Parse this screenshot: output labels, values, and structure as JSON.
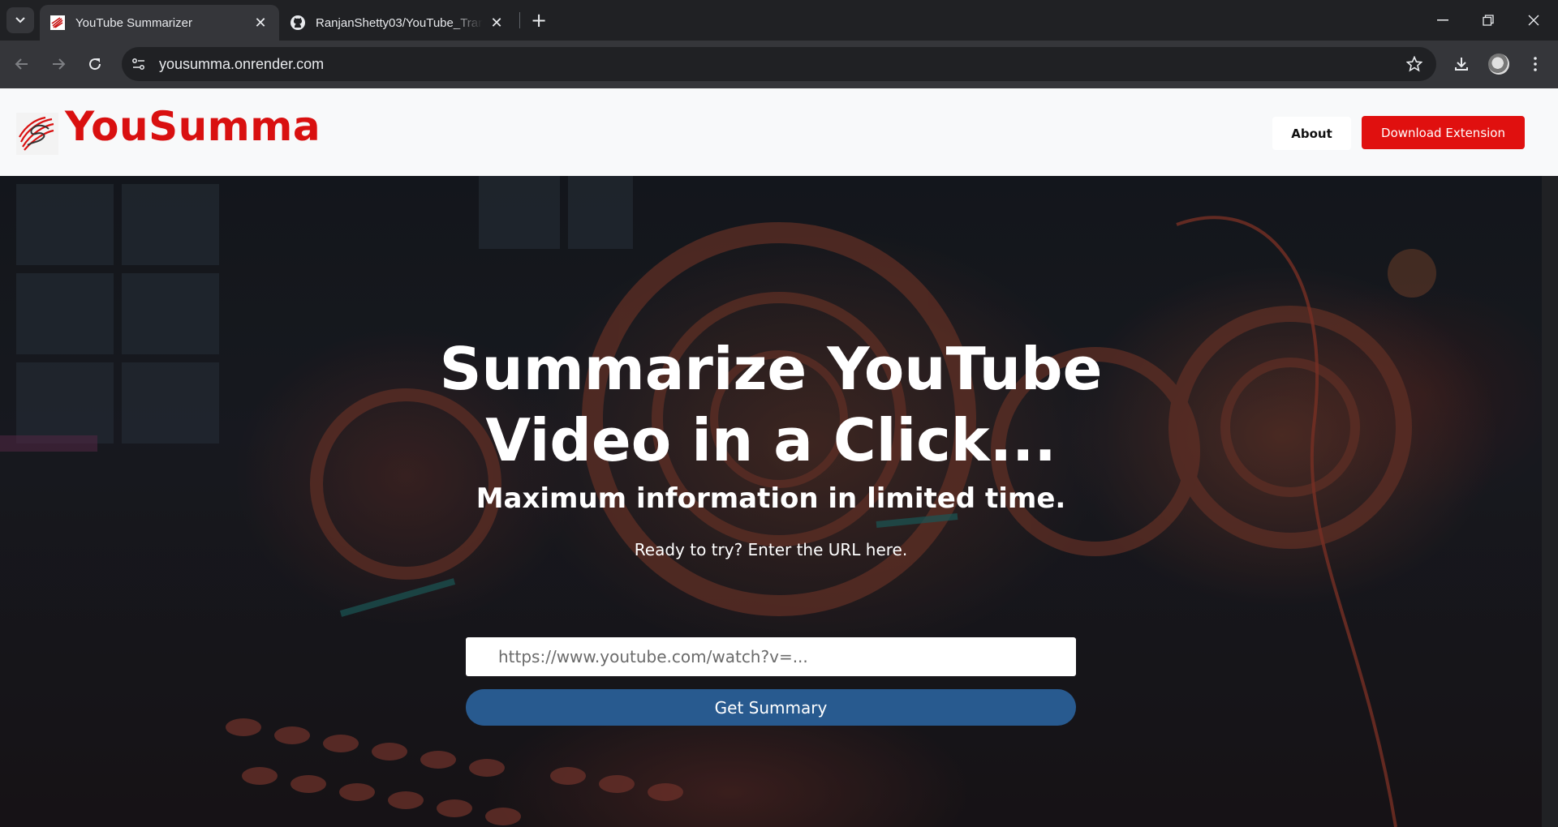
{
  "browser": {
    "tabs": [
      {
        "title": "YouTube Summarizer",
        "favicon": "yousumma-favicon",
        "active": true
      },
      {
        "title": "RanjanShetty03/YouTube_Transcript",
        "favicon": "github-icon",
        "active": false
      }
    ],
    "address": "yousumma.onrender.com"
  },
  "site": {
    "brand": "YouSumma",
    "brand_color": "#d91010",
    "nav": {
      "about": "About",
      "download": "Download Extension"
    }
  },
  "hero": {
    "title": "Summarize YouTube Video in a Click...",
    "subtitle": "Maximum information in limited time.",
    "prompt": "Ready to try? Enter the URL here.",
    "url_placeholder": "https://www.youtube.com/watch?v=...",
    "url_value": "",
    "submit_label": "Get Summary",
    "submit_color": "#285a8f"
  }
}
